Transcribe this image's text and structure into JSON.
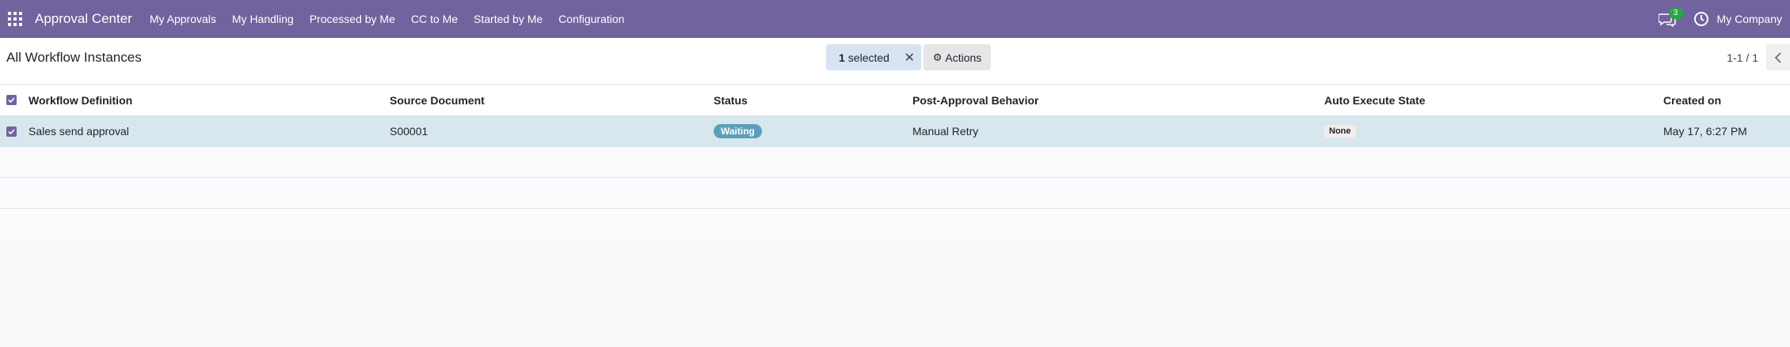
{
  "navbar": {
    "app_title": "Approval Center",
    "menu": [
      "My Approvals",
      "My Handling",
      "Processed by Me",
      "CC to Me",
      "Started by Me",
      "Configuration"
    ],
    "message_count": "3",
    "company": "My Company",
    "color": "#71639e"
  },
  "control_panel": {
    "breadcrumb": "All Workflow Instances",
    "selected_count": "1",
    "selected_label": "selected",
    "actions_label": "Actions",
    "pager": "1-1 / 1"
  },
  "table": {
    "headers": [
      "Workflow Definition",
      "Source Document",
      "Status",
      "Post-Approval Behavior",
      "Auto Execute State",
      "Created on"
    ],
    "rows": [
      {
        "workflow_definition": "Sales send approval",
        "source_document": "S00001",
        "status": "Waiting",
        "post_approval_behavior": "Manual Retry",
        "auto_execute_state": "None",
        "created_on": "May 17, 6:27 PM"
      }
    ]
  },
  "icons": {
    "apps": "apps-grid-icon",
    "chat": "chat-icon",
    "clock": "clock-icon",
    "close": "close-icon",
    "gear": "gear-icon",
    "prev": "chevron-left-icon"
  },
  "colors": {
    "status_waiting": "#5c9fbd",
    "selection_bg": "#d5e4f0",
    "selected_row": "#d8e7ee"
  }
}
